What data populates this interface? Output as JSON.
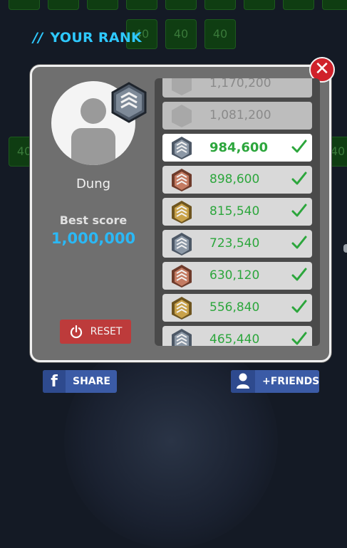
{
  "header": {
    "slash": "//",
    "title": "YOUR RANK"
  },
  "background": {
    "tile_value": "40"
  },
  "player": {
    "name": "Dung",
    "best_score_label": "Best score",
    "best_score": "1,000,000"
  },
  "buttons": {
    "reset": "RESET",
    "share": "SHARE",
    "friends": "+FRIENDS",
    "close": "✕"
  },
  "colors": {
    "accent_blue": "#2ec9ff",
    "score_green": "#2ca63c",
    "close_red": "#d0212a",
    "reset_red": "#bd3b3b",
    "facebook_blue": "#3b5ba6"
  },
  "rank_list": [
    {
      "score": "1,170,200",
      "state": "locked",
      "icon": "hexagon-icon"
    },
    {
      "score": "1,081,200",
      "state": "locked",
      "icon": "hexagon-icon"
    },
    {
      "score": "984,600",
      "state": "current",
      "icon": "rank-silver-icon",
      "achieved": true
    },
    {
      "score": "898,600",
      "state": "achieved",
      "icon": "rank-bronze-icon",
      "achieved": true
    },
    {
      "score": "815,540",
      "state": "achieved",
      "icon": "rank-gold-icon",
      "achieved": true
    },
    {
      "score": "723,540",
      "state": "achieved",
      "icon": "rank-silver-icon",
      "achieved": true
    },
    {
      "score": "630,120",
      "state": "achieved",
      "icon": "rank-bronze-icon",
      "achieved": true
    },
    {
      "score": "556,840",
      "state": "achieved",
      "icon": "rank-gold-icon",
      "achieved": true
    },
    {
      "score": "465,440",
      "state": "achieved",
      "icon": "rank-silver-icon",
      "achieved": true
    }
  ]
}
